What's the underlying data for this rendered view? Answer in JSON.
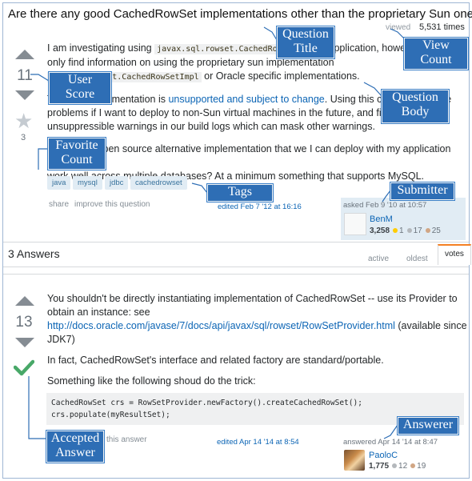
{
  "question": {
    "title": "Are there any good CachedRowSet implementations other than the proprietary Sun one?",
    "viewed_label": "viewed",
    "viewed_count": "5,531 times",
    "score": "11",
    "favorite_count": "3",
    "para1_a": "I am investigating using ",
    "para1_code": "javax.sql.rowset.CachedRowSet",
    "para1_b": " in my application, however I can",
    "para1_c": "only find information on using the proprietary sun implementation",
    "para1_code2": "com.sun.rowset.CachedRowSetImpl",
    "para1_d": " or Oracle specific implementations.",
    "para2_a": "The Sun implementation is ",
    "para2_link": "unsupported and subject to change",
    "para2_b": ". Using this could also cause",
    "para2_c": "problems if I want to deploy to non-Sun virtual machines in the future, and finally it leaves",
    "para2_d": "unsuppressible warnings in our build logs which can mask other warnings.",
    "para3_a": "Is there an open source alternative implementation that we I can deploy with my application that will",
    "para3_b": "work well across multiple databases? At a minimum something that supports MySQL.",
    "tags": [
      "java",
      "mysql",
      "jdbc",
      "cachedrowset"
    ],
    "share_label": "share",
    "improve_label": "improve this question",
    "edited": "edited Feb 7 '12 at 16:16",
    "asked": "asked Feb 9 '10 at 10:57",
    "asker_name": "BenM",
    "asker_rep": "3,258",
    "asker_gold": "1",
    "asker_silver": "17",
    "asker_bronze": "25"
  },
  "answers_header": {
    "count_label": "3 Answers",
    "tabs": [
      "active",
      "oldest",
      "votes"
    ]
  },
  "answer": {
    "score": "13",
    "line1": "You shouldn't be directly instantiating implementation of CachedRowSet -- use its Provider to",
    "line2": "obtain an instance: see",
    "link": "http://docs.oracle.com/javase/7/docs/api/javax/sql/rowset/RowSetProvider.html",
    "line3_after": " (available since",
    "line4": "JDK7)",
    "line5": "In fact, CachedRowSet's interface and related factory are standard/portable.",
    "line6": "Something like the following shoud do the trick:",
    "code1": "CachedRowSet crs = RowSetProvider.newFactory().createCachedRowSet();",
    "code2": "crs.populate(myResultSet);",
    "share_label": "this answer",
    "edited": "edited Apr 14 '14 at 8:54",
    "answered": "answered Apr 14 '14 at 8:47",
    "answerer_name": "PaoloC",
    "answerer_rep": "1,775",
    "answerer_silver": "12",
    "answerer_bronze": "19"
  },
  "callouts": {
    "question_title": [
      "Question",
      "Title"
    ],
    "view_count": [
      "View",
      "Count"
    ],
    "user_score": [
      "User",
      "Score"
    ],
    "question_body": [
      "Question",
      "Body"
    ],
    "favorite_count": [
      "Favorite",
      "Count"
    ],
    "tags": [
      "Tags"
    ],
    "submitter": [
      "Submitter"
    ],
    "answerer": [
      "Answerer"
    ],
    "accepted_answer": [
      "Accepted",
      "Answer"
    ]
  },
  "colors": {
    "callout_bg": "#2e6eb5",
    "link": "#0c65b5",
    "accepted_check": "#48a868",
    "gold": "#ffcc01",
    "silver": "#b4b8bc",
    "bronze": "#d1a684",
    "tag_bg": "#e1ecf4",
    "active_tab": "#f48024"
  },
  "icons": [
    "vote-up-icon",
    "vote-down-icon",
    "favorite-star-icon",
    "accepted-check-icon"
  ]
}
